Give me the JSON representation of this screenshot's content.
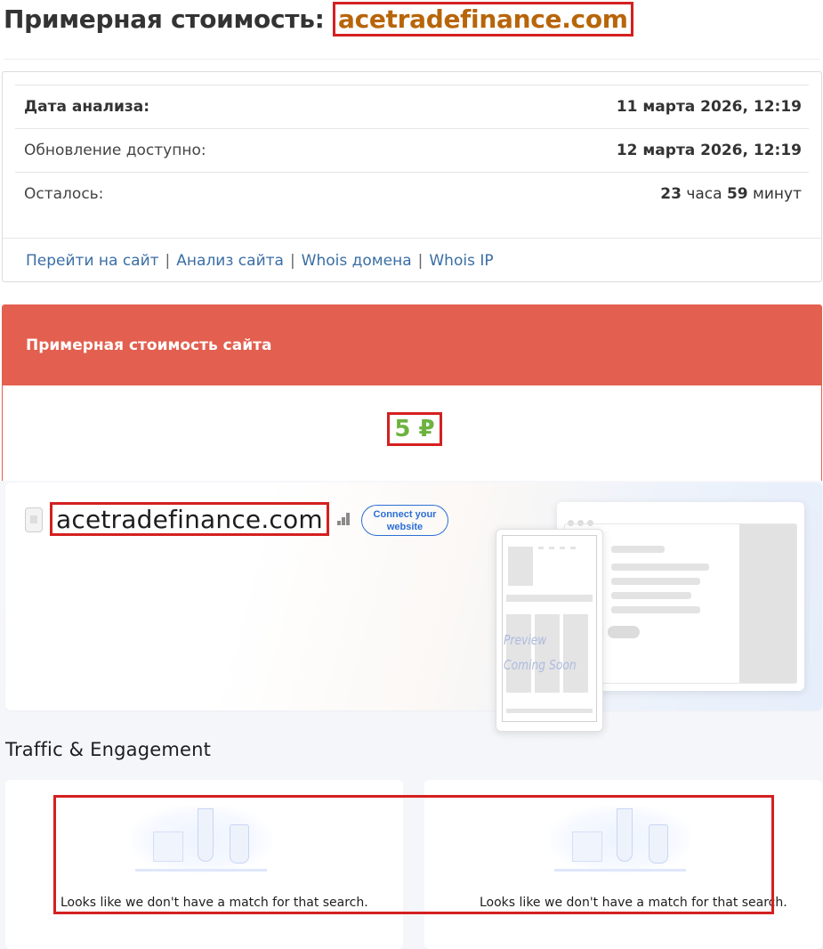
{
  "header": {
    "title_prefix": "Примерная стоимость: ",
    "domain": "acetradefinance.com"
  },
  "info": {
    "rows": [
      {
        "label": "Дата анализа:",
        "value": "11 марта 2026, 12:19"
      },
      {
        "label": "Обновление доступно:",
        "value": "12 марта 2026, 12:19"
      },
      {
        "label": "Осталось:",
        "hours": "23",
        "hours_unit": " часа ",
        "minutes": "59",
        "minutes_unit": " минут"
      }
    ],
    "links": [
      "Перейти на сайт",
      "Анализ сайта",
      "Whois домена",
      "Whois IP"
    ],
    "separator": "|"
  },
  "cost": {
    "heading": "Примерная стоимость сайта",
    "value": "5 ₽",
    "value_color": "#6cb33f",
    "accent_color": "#e35f4f"
  },
  "embed": {
    "domain": "acetradefinance.com",
    "connect_button": "Connect your website",
    "preview_line1": "Preview",
    "preview_line2": "Coming Soon",
    "section_title": "Traffic & Engagement",
    "no_match_left": "Looks like we don't have a match for that search.",
    "no_match_right": "Looks like we don't have a match for that search.",
    "icons": [
      "file-icon",
      "bar-chart-icon"
    ]
  }
}
